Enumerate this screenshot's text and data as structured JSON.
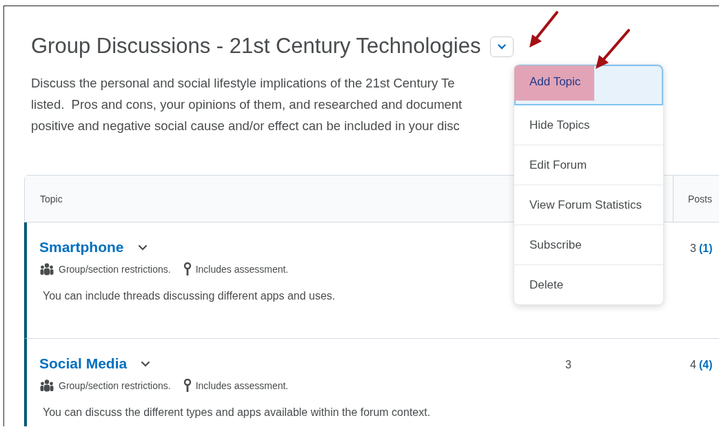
{
  "forum": {
    "title": "Group Discussions - 21st Century Technologies",
    "description_lines": [
      "Discuss the personal and social lifestyle implications of the 21st Century Te",
      "listed.  Pros and cons, your opinions of them, and researched and document",
      "positive and negative social cause and/or effect can be included in your disc"
    ]
  },
  "menu": {
    "items": [
      {
        "label": "Add Topic",
        "selected": true
      },
      {
        "label": "Hide Topics",
        "selected": false
      },
      {
        "label": "Edit Forum",
        "selected": false
      },
      {
        "label": "View Forum Statistics",
        "selected": false
      },
      {
        "label": "Subscribe",
        "selected": false
      },
      {
        "label": "Delete",
        "selected": false
      }
    ]
  },
  "table": {
    "columns": [
      "Topic",
      "Posts"
    ],
    "rows": [
      {
        "title": "Smartphone",
        "restriction": "Group/section restrictions.",
        "assessment": "Includes assessment.",
        "description": "You can include threads discussing different apps and uses.",
        "posts": "3",
        "unread": "(1)"
      },
      {
        "title": "Social Media",
        "restriction": "Group/section restrictions.",
        "assessment": "Includes assessment.",
        "description": "You can discuss the different types and apps available within the forum context.",
        "threads": "3",
        "posts": "4",
        "unread": "(4)"
      }
    ]
  }
}
